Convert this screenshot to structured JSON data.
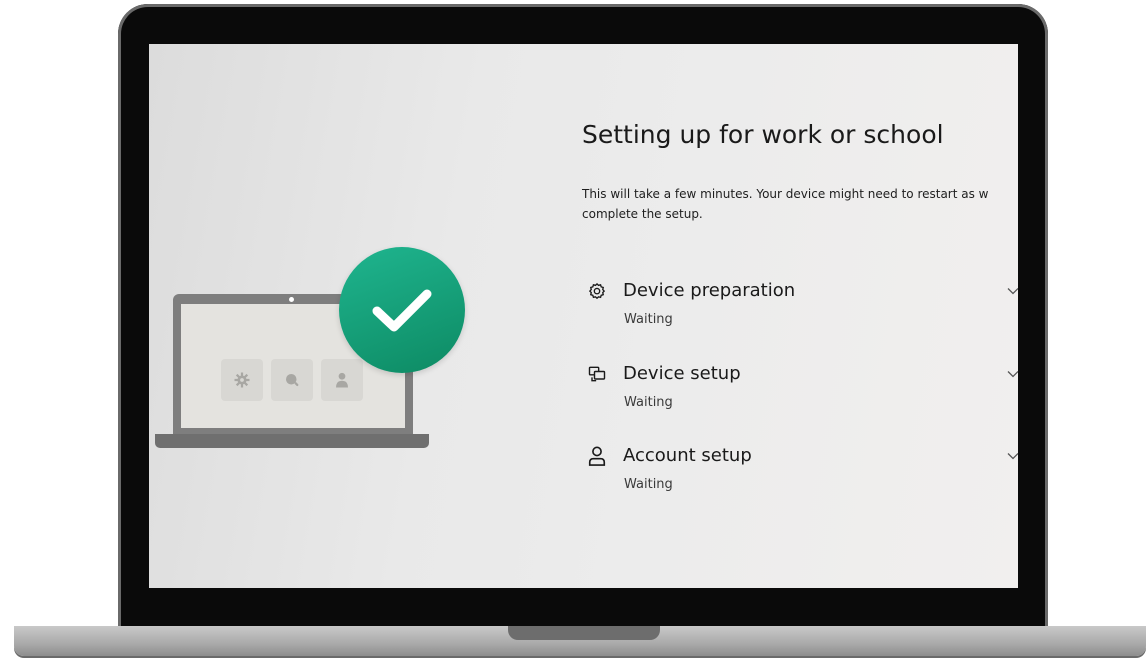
{
  "setup": {
    "title": "Setting up for work or school",
    "description_line1": "This will take a few minutes. Your device might need to restart as w",
    "description_line2": "complete the setup.",
    "steps": [
      {
        "icon": "gear-icon",
        "label": "Device preparation",
        "status": "Waiting"
      },
      {
        "icon": "devices-icon",
        "label": "Device setup",
        "status": "Waiting"
      },
      {
        "icon": "person-icon",
        "label": "Account setup",
        "status": "Waiting"
      }
    ]
  },
  "illustration": {
    "tiles": [
      "gear-icon",
      "search-icon",
      "person-icon"
    ],
    "badge": "checkmark-icon"
  },
  "colors": {
    "accent_green": "#14a07a",
    "laptop_frame": "#0a0a0a",
    "background": "#ececec"
  }
}
